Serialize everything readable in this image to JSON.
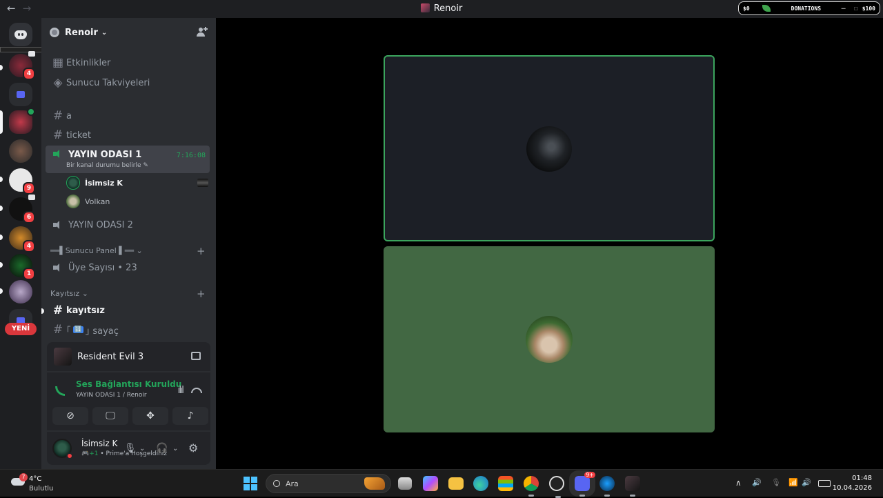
{
  "titlebar": {
    "title": "Renoir",
    "back": "←",
    "forward": "→",
    "donations": {
      "left": "$0",
      "label": "DONATIONS",
      "right": "$100",
      "min": "—",
      "max": "☐",
      "close": "✕"
    }
  },
  "rail": {
    "yeni": "YENİ",
    "badges": {
      "s1": "4",
      "s2": "9",
      "s3": "6",
      "s4": "4",
      "s5": "1"
    }
  },
  "server": {
    "name": "Renoir",
    "chevron": "⌄",
    "top_items": [
      "Etkinlikler",
      "Sunucu Takviyeleri"
    ],
    "channels": {
      "a": "a",
      "ticket": "ticket",
      "voice1": {
        "name": "YAYIN ODASI 1",
        "status": "Bir kanal durumu belirle ✎",
        "timer": "7:16:08"
      },
      "voice_users": [
        "İsimsiz K",
        "Volkan"
      ],
      "voice2": "YAYIN ODASI 2",
      "panel_category": "══▌Sunucu Panel ▌══ ⌄",
      "members": "Üye Sayısı • 23",
      "kayitsiz_category": "Kayıtsız ⌄",
      "kayitsiz_channel": "kayıtsız",
      "sayac_pre": "｢",
      "sayac_tag": "🔢",
      "sayac_post": "｣ sayaç",
      "plus": "+"
    }
  },
  "activity": {
    "game": "Resident Evil 3"
  },
  "voice": {
    "status": "Ses Bağlantısı Kuruldu",
    "channel": "YAYIN ODASI 1 / Renoir",
    "wave": "ılıl",
    "buttons": {
      "camera": "⊘",
      "screen": "🖵",
      "activities": "✥",
      "soundboard": "♪"
    }
  },
  "user": {
    "name": "İsimsiz K",
    "status_game": "🎮+1",
    "status_text": " • Prime'a Hoşgeldiniz",
    "mic": "🎙",
    "headset": "🎧",
    "chev": "⌄",
    "settings": "⚙"
  },
  "taskbar": {
    "weather_badge": "7",
    "temp": "4°C",
    "weather": "Bulutlu",
    "search": "Ara",
    "tray": {
      "up": "∧",
      "vol": "🔊",
      "mic": "🎙",
      "wifi": "📶"
    },
    "time": "01:48",
    "date": "10.04.2026",
    "discord_badge": "9+"
  },
  "colors": {
    "accent_green": "#23a55a",
    "tile_border": "#3ba55d",
    "tile2_bg": "#426843",
    "badge_red": "#f23f42"
  }
}
